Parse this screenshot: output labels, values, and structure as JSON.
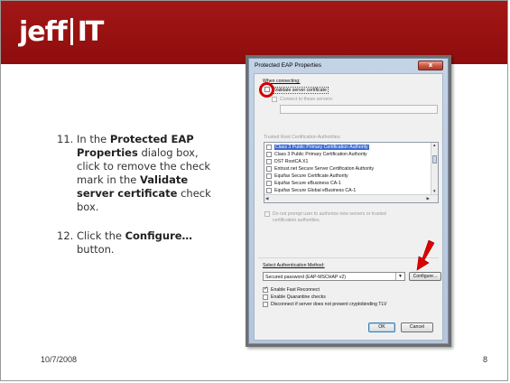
{
  "header": {
    "logo_main": "jeff",
    "logo_accent": "IT",
    "bar_color": "#9a1111"
  },
  "steps": [
    {
      "number": "11.",
      "pre": "In the ",
      "b1": "Protected EAP Properties",
      "mid": " dialog box, click to remove the check mark in the ",
      "b2": "Validate server certificate",
      "post": " check box."
    },
    {
      "number": "12.",
      "pre": "Click the ",
      "b1": "Configure…",
      "post": " button."
    }
  ],
  "footer": {
    "date": "10/7/2008",
    "page": "8"
  },
  "dialog": {
    "title": "Protected EAP Properties",
    "close_label": "x",
    "when_connecting": "When connecting:",
    "validate_server_cert": {
      "label": "Validate server certificate",
      "checked": false
    },
    "connect_to_servers": {
      "label": "Connect to these servers:",
      "checked": false,
      "value": ""
    },
    "trusted_root_label": "Trusted Root Certification Authorities:",
    "trusted_roots": [
      {
        "label": "Class 3 Public Primary Certification Authority",
        "checked": false,
        "selected": true
      },
      {
        "label": "Class 3 Public Primary Certification Authority",
        "checked": false,
        "selected": false
      },
      {
        "label": "DST RootCA X1",
        "checked": false,
        "selected": false
      },
      {
        "label": "Entrust.net Secure Server Certification Authority",
        "checked": false,
        "selected": false
      },
      {
        "label": "Equifax Secure Certificate Authority",
        "checked": false,
        "selected": false
      },
      {
        "label": "Equifax Secure eBusiness CA-1",
        "checked": false,
        "selected": false
      },
      {
        "label": "Equifax Secure Global eBusiness CA-1",
        "checked": false,
        "selected": false
      }
    ],
    "do_not_prompt_line1": "Do not prompt user to authorize new servers or trusted",
    "do_not_prompt_line2": "certification authorities.",
    "auth_method_label": "Select Authentication Method:",
    "auth_method_value": "Secured password (EAP-MSCHAP v2)",
    "configure_button": "Configure...",
    "fast_reconnect": {
      "label": "Enable Fast Reconnect",
      "checked": true
    },
    "quarantine": {
      "label": "Enable Quarantine checks",
      "checked": false
    },
    "disconnect_crypto": {
      "label": "Disconnect if server does not present cryptobinding TLV",
      "checked": false
    },
    "ok_button": "OK",
    "cancel_button": "Cancel"
  },
  "colors": {
    "highlight_red": "#d40000",
    "selection_blue": "#3a6ad1"
  }
}
